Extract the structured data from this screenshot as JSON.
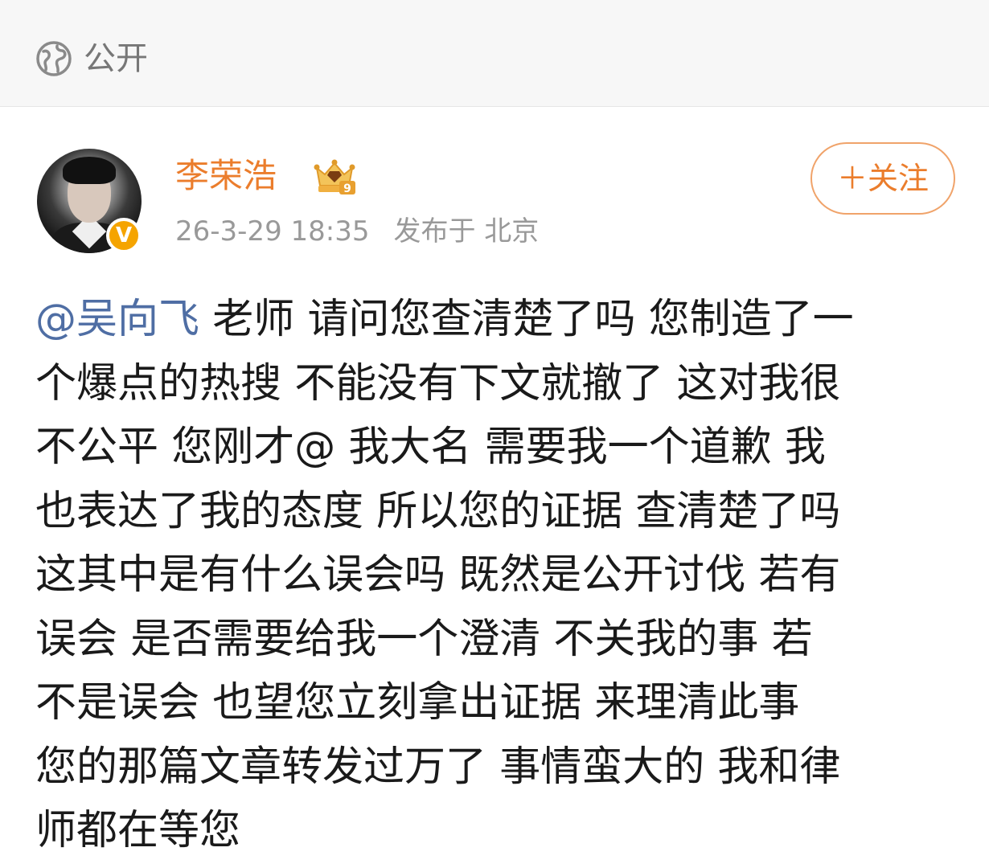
{
  "visibility": {
    "icon": "globe-icon",
    "label": "公开"
  },
  "post": {
    "author": {
      "name": "李荣浩",
      "avatar": "avatar",
      "verified_icon": "verified-v-icon",
      "verified_mark": "V",
      "member_icon": "crown-member-icon",
      "member_level": "9"
    },
    "timestamp": "26-3-29 18:35",
    "location": "发布于 北京",
    "follow_label": "＋关注",
    "mention": "@吴向飞",
    "text_lines": [
      " 老师 请问您查清楚了吗 您制造了一",
      "个爆点的热搜 不能没有下文就撤了 这对我很",
      "不公平 您刚才@ 我大名 需要我一个道歉 我",
      "也表达了我的态度 所以您的证据 查清楚了吗",
      "这其中是有什么误会吗 既然是公开讨伐 若有",
      "误会 是否需要给我一个澄清 不关我的事 若",
      "不是误会 也望您立刻拿出证据 来理清此事",
      "您的那篇文章转发过万了 事情蛮大的 我和律",
      "师都在等您"
    ]
  },
  "colors": {
    "author_name": "#eb7d2c",
    "mention": "#4f6ea4",
    "meta": "#999999",
    "follow_border": "#f0a36a",
    "verified_badge": "#f5a400",
    "top_bar_bg": "#f7f7f7"
  }
}
